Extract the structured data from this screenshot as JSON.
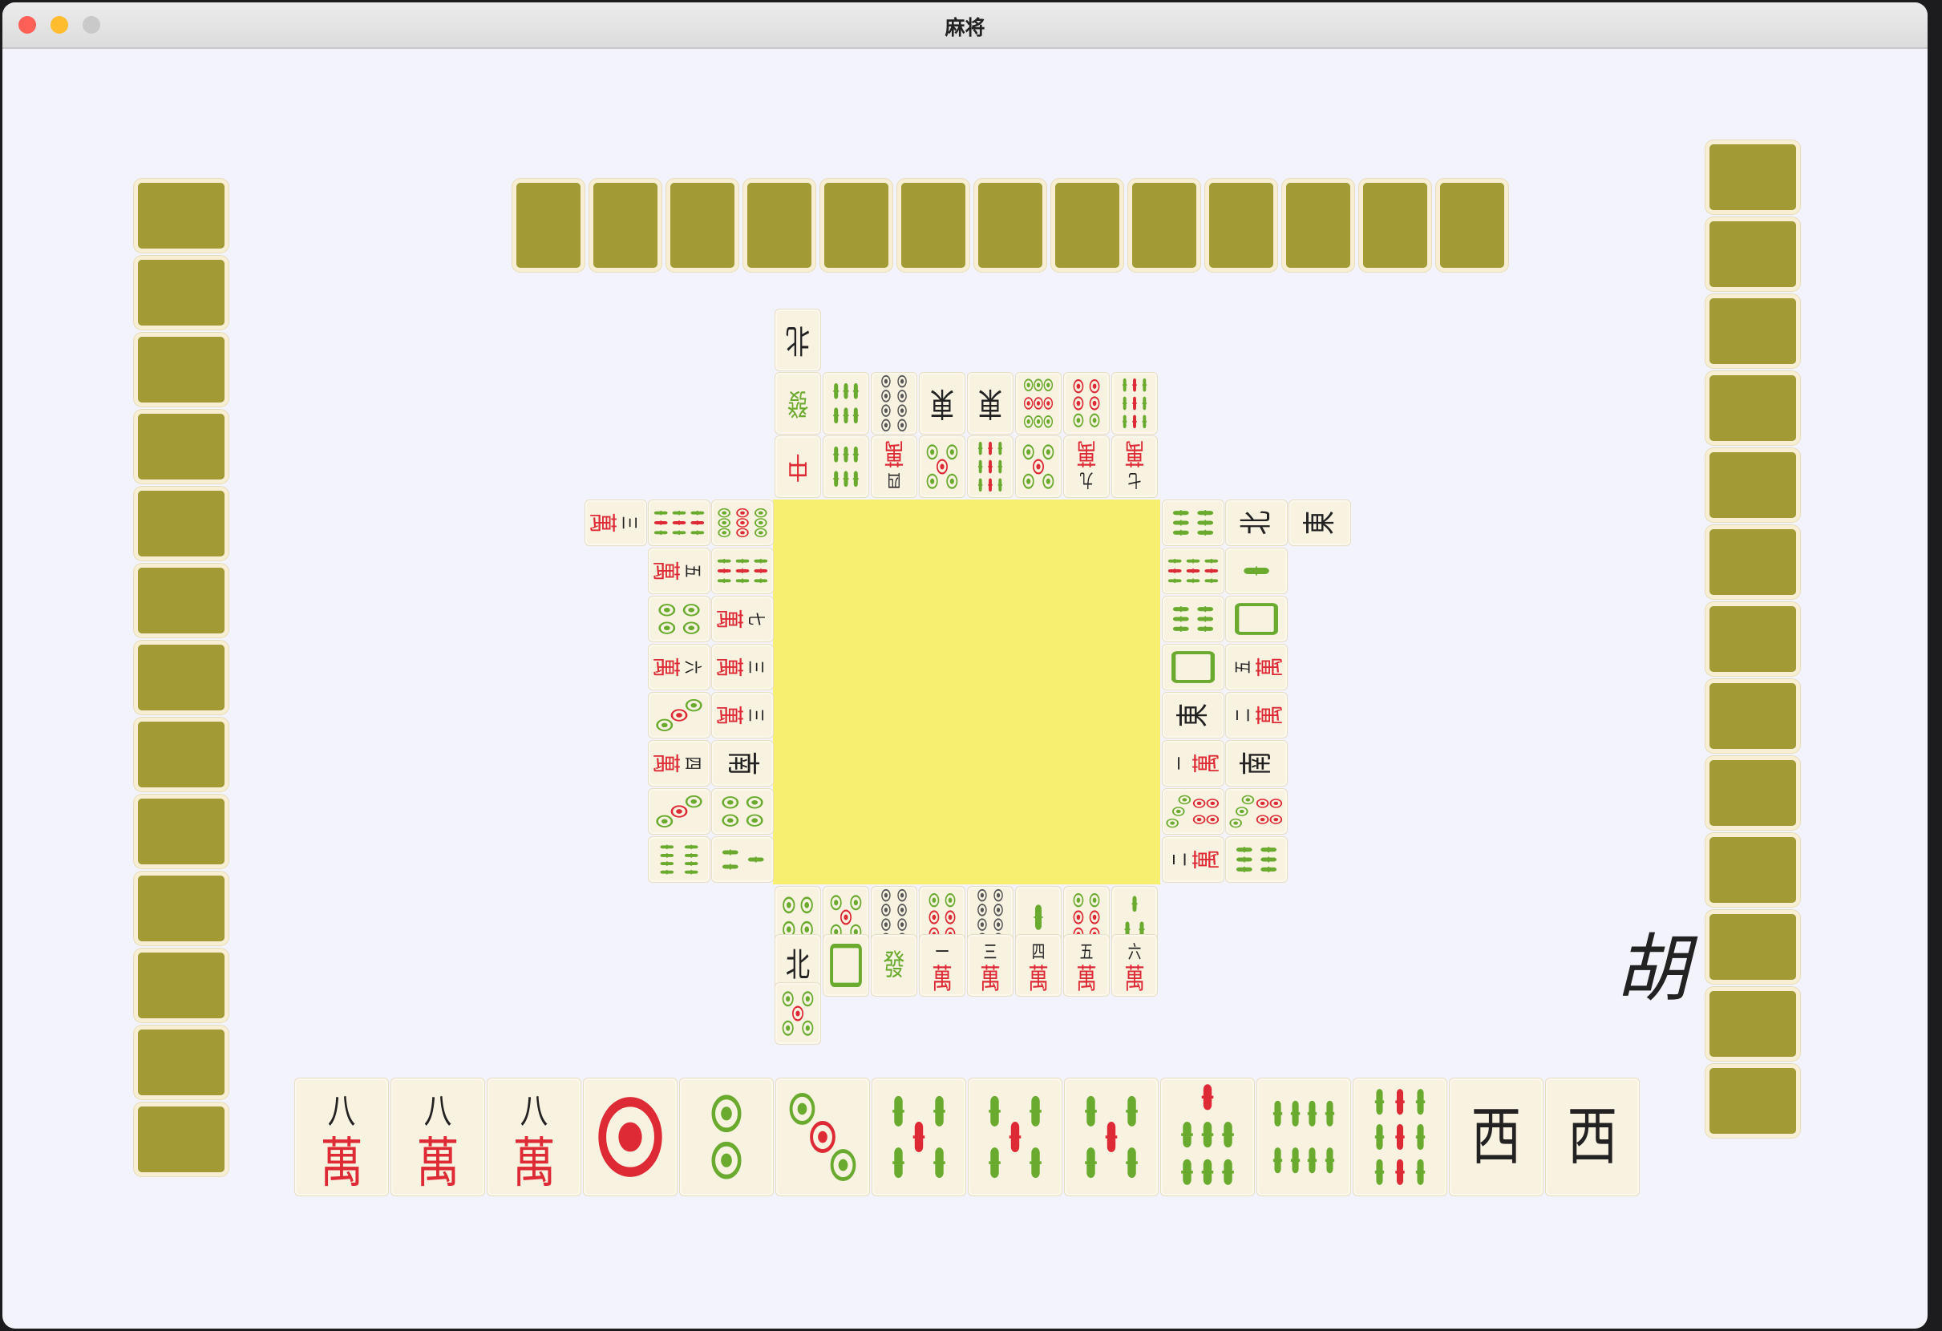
{
  "window": {
    "title": "麻将",
    "colors": {
      "close": "#fe5f57",
      "minimize": "#febc2e",
      "zoom": "#c9c9c9"
    }
  },
  "colors": {
    "background": "#f3f3fc",
    "table": "#f6ef70",
    "tile_face": "#f8f3e1",
    "tile_back": "#a19a35",
    "tile_back_border": "#f7eed3",
    "green": "#6aaa2e",
    "red": "#dd2a35",
    "dark": "#555555",
    "ink": "#222222"
  },
  "opponents": {
    "top": {
      "hidden_tiles": 13
    },
    "left": {
      "hidden_tiles": 13
    },
    "right": {
      "hidden_tiles": 13
    }
  },
  "player_hand": [
    {
      "kind": "wan",
      "num": "八"
    },
    {
      "kind": "wan",
      "num": "八"
    },
    {
      "kind": "wan",
      "num": "八"
    },
    {
      "kind": "dots",
      "n": 1
    },
    {
      "kind": "dots",
      "n": 2
    },
    {
      "kind": "dots",
      "n": 3
    },
    {
      "kind": "bam",
      "n": 5
    },
    {
      "kind": "bam",
      "n": 5
    },
    {
      "kind": "bam",
      "n": 5
    },
    {
      "kind": "bam",
      "n": 7
    },
    {
      "kind": "bam",
      "n": 8
    },
    {
      "kind": "bam",
      "n": 9
    },
    {
      "kind": "honor",
      "text": "西"
    },
    {
      "kind": "honor",
      "text": "西"
    }
  ],
  "discards": {
    "bottom": [
      {
        "kind": "dots",
        "n": 4
      },
      {
        "kind": "dots",
        "n": 5
      },
      {
        "kind": "dots",
        "n": 8
      },
      {
        "kind": "dots",
        "n": 6
      },
      {
        "kind": "dots",
        "n": 8
      },
      {
        "kind": "bam",
        "n": 1
      },
      {
        "kind": "dots",
        "n": 6
      },
      {
        "kind": "bam",
        "n": 3
      },
      {
        "kind": "honor",
        "text": "北"
      },
      {
        "kind": "white"
      },
      {
        "kind": "green"
      },
      {
        "kind": "wan",
        "num": "一"
      },
      {
        "kind": "wan",
        "num": "三"
      },
      {
        "kind": "wan",
        "num": "四"
      },
      {
        "kind": "wan",
        "num": "五"
      },
      {
        "kind": "wan",
        "num": "六"
      },
      {
        "kind": "dots",
        "n": 5
      }
    ],
    "top": [
      {
        "kind": "red"
      },
      {
        "kind": "bam",
        "n": 6
      },
      {
        "kind": "wan",
        "num": "四"
      },
      {
        "kind": "dots",
        "n": 5
      },
      {
        "kind": "bam",
        "n": 9
      },
      {
        "kind": "dots",
        "n": 5
      },
      {
        "kind": "wan",
        "num": "九"
      },
      {
        "kind": "wan",
        "num": "七"
      },
      {
        "kind": "green"
      },
      {
        "kind": "bam",
        "n": 6
      },
      {
        "kind": "dots",
        "n": 8
      },
      {
        "kind": "honor",
        "text": "東"
      },
      {
        "kind": "honor",
        "text": "東"
      },
      {
        "kind": "dots",
        "n": 9
      },
      {
        "kind": "dots",
        "n": 6
      },
      {
        "kind": "bam",
        "n": 9
      },
      {
        "kind": "honor",
        "text": "北"
      }
    ],
    "left": [
      {
        "kind": "dots",
        "n": 9
      },
      {
        "kind": "bam",
        "n": 9
      },
      {
        "kind": "wan",
        "num": "七"
      },
      {
        "kind": "wan",
        "num": "三"
      },
      {
        "kind": "wan",
        "num": "三"
      },
      {
        "kind": "honor",
        "text": "南"
      },
      {
        "kind": "dots",
        "n": 4
      },
      {
        "kind": "bam",
        "n": 3
      },
      {
        "kind": "bam",
        "n": 9
      },
      {
        "kind": "wan",
        "num": "五"
      },
      {
        "kind": "dots",
        "n": 4
      },
      {
        "kind": "wan",
        "num": "六"
      },
      {
        "kind": "dots",
        "n": 3
      },
      {
        "kind": "wan",
        "num": "四"
      },
      {
        "kind": "dots",
        "n": 3
      },
      {
        "kind": "bam",
        "n": 8
      },
      {
        "kind": "wan",
        "num": "三"
      }
    ],
    "right": [
      {
        "kind": "bam",
        "n": 6
      },
      {
        "kind": "bam",
        "n": 9
      },
      {
        "kind": "bam",
        "n": 6
      },
      {
        "kind": "white"
      },
      {
        "kind": "honor",
        "text": "東"
      },
      {
        "kind": "wan",
        "num": "一"
      },
      {
        "kind": "dots",
        "n": 7
      },
      {
        "kind": "wan",
        "num": "二"
      },
      {
        "kind": "honor",
        "text": "北"
      },
      {
        "kind": "bam",
        "n": 1
      },
      {
        "kind": "white"
      },
      {
        "kind": "wan",
        "num": "五"
      },
      {
        "kind": "wan",
        "num": "二"
      },
      {
        "kind": "honor",
        "text": "南"
      },
      {
        "kind": "dots",
        "n": 7
      },
      {
        "kind": "bam",
        "n": 6
      },
      {
        "kind": "honor",
        "text": "東"
      }
    ]
  },
  "hu_label": "胡"
}
